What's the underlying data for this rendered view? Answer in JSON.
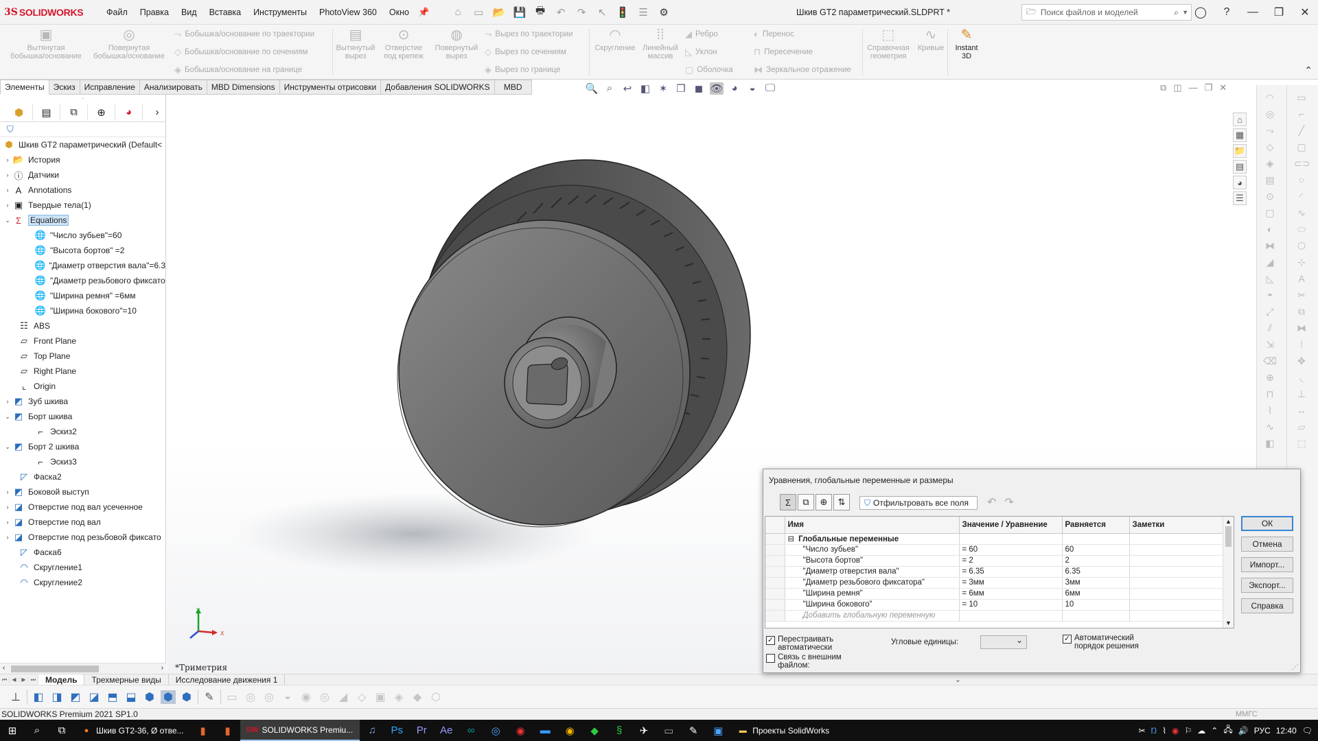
{
  "app": {
    "brand_ds": "3S",
    "brand_name": "SOLIDWORKS",
    "menu": [
      "Файл",
      "Правка",
      "Вид",
      "Вставка",
      "Инструменты",
      "PhotoView 360",
      "Окно"
    ],
    "document_title": "Шкив GT2 параметрический.SLDPRT *",
    "search_placeholder": "Поиск файлов и моделей"
  },
  "ribbon": {
    "extruded_boss": "Вытянутая\nбобышка/основание",
    "revolved_boss": "Повернутая\nбобышка/основание",
    "swept_boss": "Бобышка/основание по траектории",
    "lofted_boss": "Бобышка/основание по сечениям",
    "boundary_boss": "Бобышка/основание на границе",
    "extruded_cut": "Вытянутый\nвырез",
    "hole_wizard": "Отверстие\nпод крепеж",
    "revolved_cut": "Повернутый\nвырез",
    "swept_cut": "Вырез по траектории",
    "lofted_cut": "Вырез по сечениям",
    "boundary_cut": "Вырез по границе",
    "fillet": "Скругление",
    "linear_pattern": "Линейный\nмассив",
    "rib": "Ребро",
    "draft": "Уклон",
    "shell": "Оболочка",
    "wrap": "Перенос",
    "intersect": "Пересечение",
    "mirror": "Зеркальное отражение",
    "ref_geometry": "Справочная\nгеометрия",
    "curves": "Кривые",
    "instant3d": "Instant\n3D"
  },
  "command_tabs": [
    "Элементы",
    "Эскиз",
    "Исправление",
    "Анализировать",
    "MBD Dimensions",
    "Инструменты отрисовки",
    "Добавления SOLIDWORKS",
    "MBD"
  ],
  "tree": {
    "root": "Шкив GT2 параметрический  (Default<",
    "items": [
      {
        "label": "История"
      },
      {
        "label": "Датчики"
      },
      {
        "label": "Annotations"
      },
      {
        "label": "Твердые тела(1)"
      },
      {
        "label": "Equations"
      },
      {
        "label": "\"Число зубьев\"=60"
      },
      {
        "label": "\"Высота бортов\" =2"
      },
      {
        "label": "\"Диаметр отверстия вала\"=6.3"
      },
      {
        "label": "\"Диаметр резьбового фиксато"
      },
      {
        "label": "\"Ширина ремня\" =6мм"
      },
      {
        "label": "\"Ширина бокового\"=10"
      },
      {
        "label": "ABS"
      },
      {
        "label": "Front Plane"
      },
      {
        "label": "Top Plane"
      },
      {
        "label": "Right Plane"
      },
      {
        "label": "Origin"
      },
      {
        "label": "Зуб шкива"
      },
      {
        "label": "Борт шкива"
      },
      {
        "label": "Эскиз2"
      },
      {
        "label": "Борт 2 шкива"
      },
      {
        "label": "Эскиз3"
      },
      {
        "label": "Фаска2"
      },
      {
        "label": "Боковой выступ"
      },
      {
        "label": "Отверстие под вал усеченное"
      },
      {
        "label": "Отверстие под вал"
      },
      {
        "label": "Отверстие под резьбовой фиксато"
      },
      {
        "label": "Фаска6"
      },
      {
        "label": "Скругление1"
      },
      {
        "label": "Скругление2"
      }
    ]
  },
  "viewport": {
    "view_name": "*Триметрия",
    "triad_y": "Y",
    "triad_x": "X"
  },
  "bottom_tabs": [
    "Модель",
    "Трехмерные виды",
    "Исследование движения 1"
  ],
  "status": {
    "version": "SOLIDWORKS Premium 2021 SP1.0",
    "units": "ММГС"
  },
  "dialog": {
    "title": "Уравнения, глобальные переменные и размеры",
    "filter_label": "Отфильтровать все поля",
    "columns": [
      "Имя",
      "Значение / Уравнение",
      "Равняется",
      "Заметки"
    ],
    "group": "Глобальные переменные",
    "rows": [
      {
        "name": "\"Число зубьев\"",
        "value": "= 60",
        "eval": "60"
      },
      {
        "name": "\"Высота бортов\"",
        "value": "= 2",
        "eval": "2"
      },
      {
        "name": "\"Диаметр отверстия вала\"",
        "value": "= 6.35",
        "eval": "6.35"
      },
      {
        "name": "\"Диаметр резьбового фиксатора\"",
        "value": "= 3мм",
        "eval": "3мм"
      },
      {
        "name": "\"Ширина ремня\"",
        "value": "= 6мм",
        "eval": "6мм"
      },
      {
        "name": "\"Ширина бокового\"",
        "value": "= 10",
        "eval": "10"
      }
    ],
    "add_placeholder": "Добавить глобальную переменную",
    "buttons": {
      "ok": "ОК",
      "cancel": "Отмена",
      "import": "Импорт...",
      "export": "Экспорт...",
      "help": "Справка"
    },
    "auto_rebuild": "Перестраивать\nавтоматически",
    "link_external": "Связь с внешним\nфайлом:",
    "angular_units": "Угловые единицы:",
    "auto_order": "Автоматический\nпорядок решения"
  },
  "taskbar": {
    "apps": [
      {
        "label": "Шкив GT2-36, Ø отве..."
      },
      {
        "label": "SOLIDWORKS Premiu..."
      },
      {
        "label": "Проекты SolidWorks"
      }
    ],
    "lang": "РУС",
    "time": "12:40"
  },
  "colors": {
    "brand_red": "#d4142a",
    "selection_blue": "#cde3f7",
    "model_gray": "#6b6b6b"
  }
}
